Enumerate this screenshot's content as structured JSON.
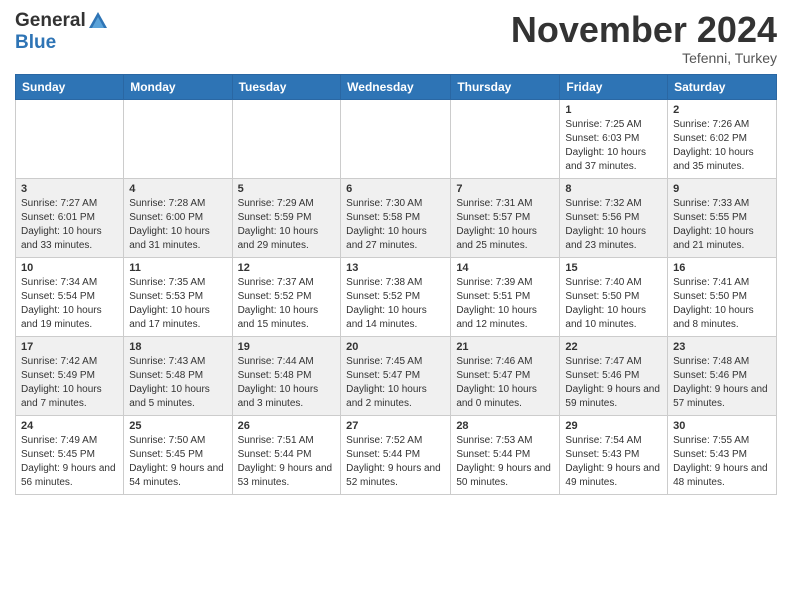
{
  "header": {
    "logo_line1": "General",
    "logo_line2": "Blue",
    "month_title": "November 2024",
    "location": "Tefenni, Turkey"
  },
  "days_of_week": [
    "Sunday",
    "Monday",
    "Tuesday",
    "Wednesday",
    "Thursday",
    "Friday",
    "Saturday"
  ],
  "weeks": [
    [
      {
        "day": "",
        "info": ""
      },
      {
        "day": "",
        "info": ""
      },
      {
        "day": "",
        "info": ""
      },
      {
        "day": "",
        "info": ""
      },
      {
        "day": "",
        "info": ""
      },
      {
        "day": "1",
        "info": "Sunrise: 7:25 AM\nSunset: 6:03 PM\nDaylight: 10 hours and 37 minutes."
      },
      {
        "day": "2",
        "info": "Sunrise: 7:26 AM\nSunset: 6:02 PM\nDaylight: 10 hours and 35 minutes."
      }
    ],
    [
      {
        "day": "3",
        "info": "Sunrise: 7:27 AM\nSunset: 6:01 PM\nDaylight: 10 hours and 33 minutes."
      },
      {
        "day": "4",
        "info": "Sunrise: 7:28 AM\nSunset: 6:00 PM\nDaylight: 10 hours and 31 minutes."
      },
      {
        "day": "5",
        "info": "Sunrise: 7:29 AM\nSunset: 5:59 PM\nDaylight: 10 hours and 29 minutes."
      },
      {
        "day": "6",
        "info": "Sunrise: 7:30 AM\nSunset: 5:58 PM\nDaylight: 10 hours and 27 minutes."
      },
      {
        "day": "7",
        "info": "Sunrise: 7:31 AM\nSunset: 5:57 PM\nDaylight: 10 hours and 25 minutes."
      },
      {
        "day": "8",
        "info": "Sunrise: 7:32 AM\nSunset: 5:56 PM\nDaylight: 10 hours and 23 minutes."
      },
      {
        "day": "9",
        "info": "Sunrise: 7:33 AM\nSunset: 5:55 PM\nDaylight: 10 hours and 21 minutes."
      }
    ],
    [
      {
        "day": "10",
        "info": "Sunrise: 7:34 AM\nSunset: 5:54 PM\nDaylight: 10 hours and 19 minutes."
      },
      {
        "day": "11",
        "info": "Sunrise: 7:35 AM\nSunset: 5:53 PM\nDaylight: 10 hours and 17 minutes."
      },
      {
        "day": "12",
        "info": "Sunrise: 7:37 AM\nSunset: 5:52 PM\nDaylight: 10 hours and 15 minutes."
      },
      {
        "day": "13",
        "info": "Sunrise: 7:38 AM\nSunset: 5:52 PM\nDaylight: 10 hours and 14 minutes."
      },
      {
        "day": "14",
        "info": "Sunrise: 7:39 AM\nSunset: 5:51 PM\nDaylight: 10 hours and 12 minutes."
      },
      {
        "day": "15",
        "info": "Sunrise: 7:40 AM\nSunset: 5:50 PM\nDaylight: 10 hours and 10 minutes."
      },
      {
        "day": "16",
        "info": "Sunrise: 7:41 AM\nSunset: 5:50 PM\nDaylight: 10 hours and 8 minutes."
      }
    ],
    [
      {
        "day": "17",
        "info": "Sunrise: 7:42 AM\nSunset: 5:49 PM\nDaylight: 10 hours and 7 minutes."
      },
      {
        "day": "18",
        "info": "Sunrise: 7:43 AM\nSunset: 5:48 PM\nDaylight: 10 hours and 5 minutes."
      },
      {
        "day": "19",
        "info": "Sunrise: 7:44 AM\nSunset: 5:48 PM\nDaylight: 10 hours and 3 minutes."
      },
      {
        "day": "20",
        "info": "Sunrise: 7:45 AM\nSunset: 5:47 PM\nDaylight: 10 hours and 2 minutes."
      },
      {
        "day": "21",
        "info": "Sunrise: 7:46 AM\nSunset: 5:47 PM\nDaylight: 10 hours and 0 minutes."
      },
      {
        "day": "22",
        "info": "Sunrise: 7:47 AM\nSunset: 5:46 PM\nDaylight: 9 hours and 59 minutes."
      },
      {
        "day": "23",
        "info": "Sunrise: 7:48 AM\nSunset: 5:46 PM\nDaylight: 9 hours and 57 minutes."
      }
    ],
    [
      {
        "day": "24",
        "info": "Sunrise: 7:49 AM\nSunset: 5:45 PM\nDaylight: 9 hours and 56 minutes."
      },
      {
        "day": "25",
        "info": "Sunrise: 7:50 AM\nSunset: 5:45 PM\nDaylight: 9 hours and 54 minutes."
      },
      {
        "day": "26",
        "info": "Sunrise: 7:51 AM\nSunset: 5:44 PM\nDaylight: 9 hours and 53 minutes."
      },
      {
        "day": "27",
        "info": "Sunrise: 7:52 AM\nSunset: 5:44 PM\nDaylight: 9 hours and 52 minutes."
      },
      {
        "day": "28",
        "info": "Sunrise: 7:53 AM\nSunset: 5:44 PM\nDaylight: 9 hours and 50 minutes."
      },
      {
        "day": "29",
        "info": "Sunrise: 7:54 AM\nSunset: 5:43 PM\nDaylight: 9 hours and 49 minutes."
      },
      {
        "day": "30",
        "info": "Sunrise: 7:55 AM\nSunset: 5:43 PM\nDaylight: 9 hours and 48 minutes."
      }
    ]
  ]
}
